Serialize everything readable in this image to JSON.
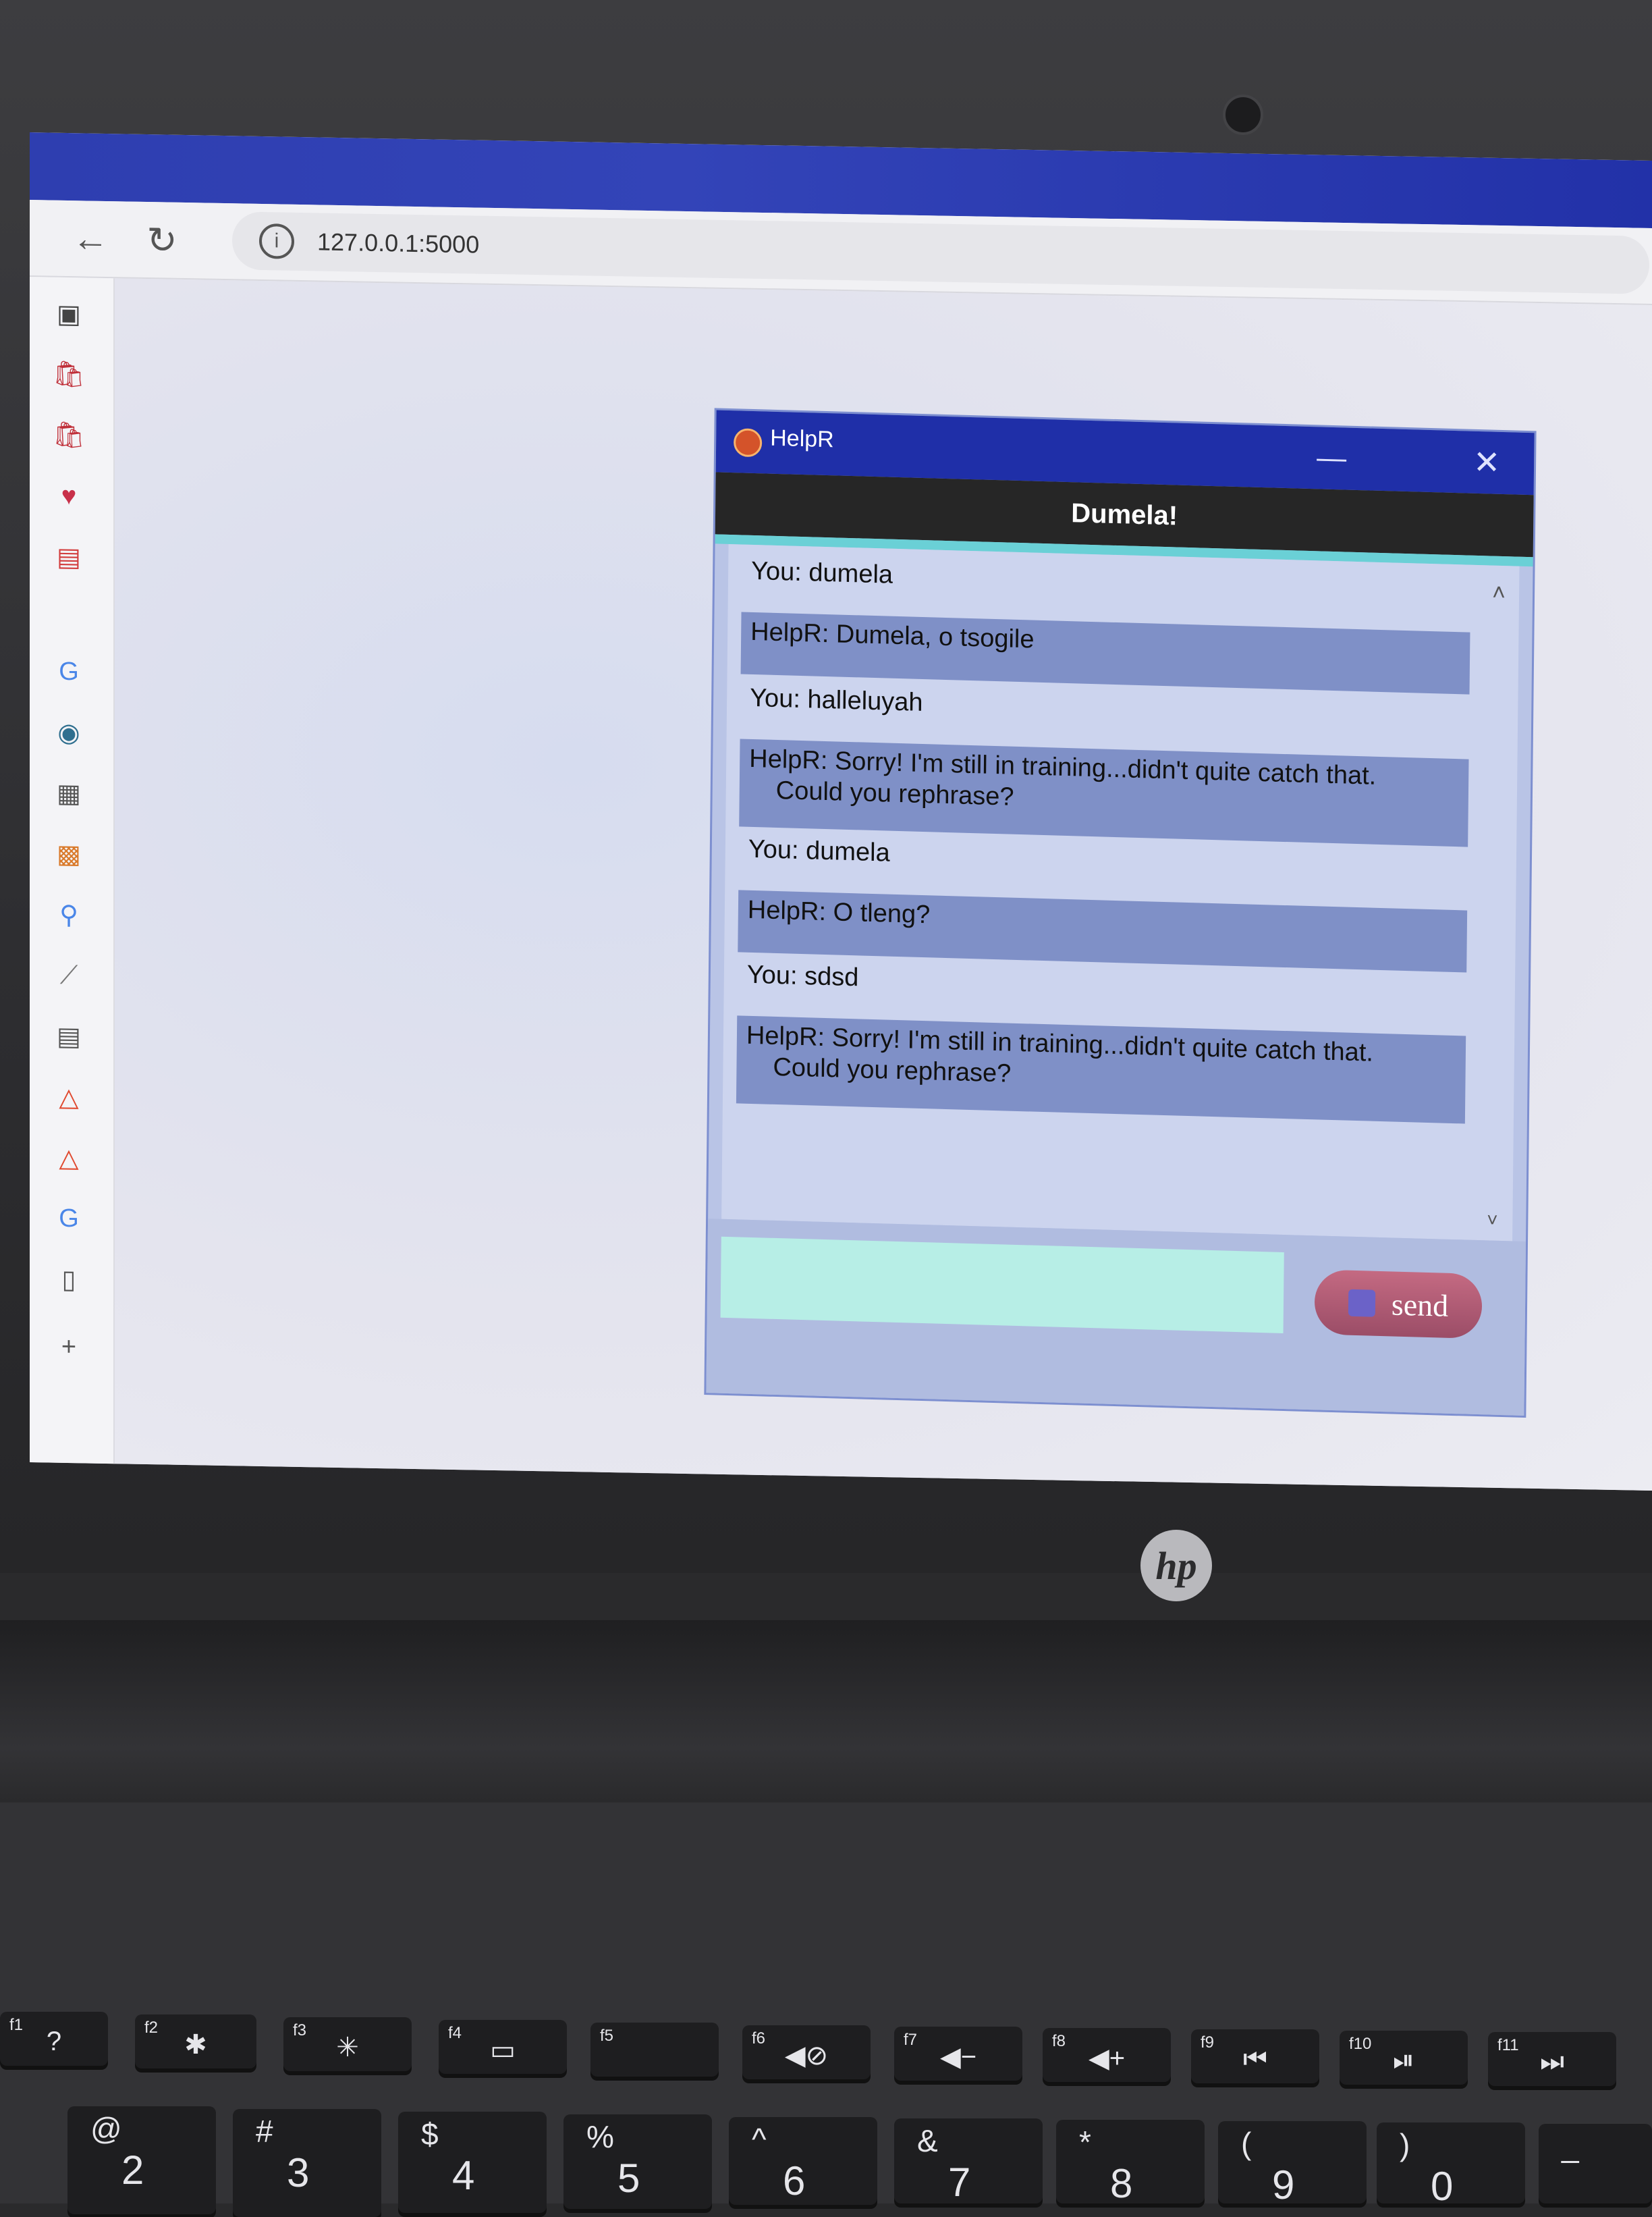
{
  "browser": {
    "url": "127.0.0.1:5000"
  },
  "chat_window": {
    "title": "HelpR",
    "header": "Dumela!",
    "messages": [
      {
        "line1": "You: dumela",
        "line2": ""
      },
      {
        "line1": "HelpR: Dumela, o tsogile",
        "line2": ""
      },
      {
        "line1": "You: halleluyah",
        "line2": ""
      },
      {
        "line1": "HelpR: Sorry! I'm still in training...didn't quite catch that.",
        "line2": "Could you rephrase?"
      },
      {
        "line1": "You: dumela",
        "line2": ""
      },
      {
        "line1": "HelpR: O tleng?",
        "line2": ""
      },
      {
        "line1": "You: sdsd",
        "line2": ""
      },
      {
        "line1": "HelpR: Sorry! I'm still in training...didn't quite catch that.",
        "line2": "Could you rephrase?"
      }
    ],
    "input_value": "",
    "send_label": "send"
  },
  "laptop": {
    "brand": "hp",
    "fn_keys": [
      {
        "fn": "f1",
        "glyph": "?"
      },
      {
        "fn": "f2",
        "glyph": "✱"
      },
      {
        "fn": "f3",
        "glyph": "✳"
      },
      {
        "fn": "f4",
        "glyph": "▭"
      },
      {
        "fn": "f5",
        "glyph": ""
      },
      {
        "fn": "f6",
        "glyph": "◀⊘"
      },
      {
        "fn": "f7",
        "glyph": "◀−"
      },
      {
        "fn": "f8",
        "glyph": "◀+"
      },
      {
        "fn": "f9",
        "glyph": "⏮"
      },
      {
        "fn": "f10",
        "glyph": "⏯"
      },
      {
        "fn": "f11",
        "glyph": "⏭"
      }
    ],
    "number_keys": [
      {
        "sym": "@",
        "num": "2"
      },
      {
        "sym": "#",
        "num": "3"
      },
      {
        "sym": "$",
        "num": "4"
      },
      {
        "sym": "%",
        "num": "5"
      },
      {
        "sym": "^",
        "num": "6"
      },
      {
        "sym": "&",
        "num": "7"
      },
      {
        "sym": "*",
        "num": "8"
      },
      {
        "sym": "(",
        "num": "9"
      },
      {
        "sym": ")",
        "num": "0"
      },
      {
        "sym": "_",
        "num": ""
      }
    ]
  },
  "colors": {
    "window_title_bar": "#1f2fa8",
    "chat_header": "#262626",
    "accent_strip": "#6ad0d6",
    "bot_bubble": "#7f90c7",
    "input_bg": "#b7eee6",
    "send_button": "#b05c76"
  },
  "icons": {
    "back": "arrow-left-icon",
    "reload": "reload-icon",
    "info": "info-icon",
    "minimize": "minimize-icon",
    "close": "close-icon"
  }
}
